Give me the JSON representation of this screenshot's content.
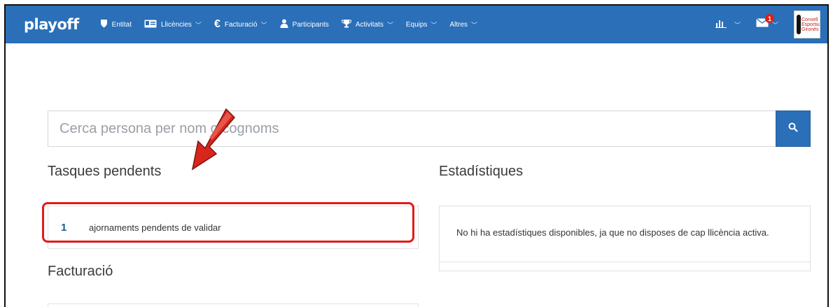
{
  "navbar": {
    "brand": "playoff",
    "items": [
      {
        "label": "Entitat",
        "icon": "shield-icon",
        "dropdown": false
      },
      {
        "label": "Llicències",
        "icon": "id-card-icon",
        "dropdown": true
      },
      {
        "label": "Facturació",
        "icon": "euro-icon",
        "dropdown": true
      },
      {
        "label": "Participants",
        "icon": "user-icon",
        "dropdown": false
      },
      {
        "label": "Activitats",
        "icon": "trophy-icon",
        "dropdown": true
      },
      {
        "label": "Equips",
        "icon": "",
        "dropdown": true
      },
      {
        "label": "Altres",
        "icon": "",
        "dropdown": true
      }
    ],
    "right": {
      "stats_icon": "bar-chart-icon",
      "mail_icon": "mail-icon",
      "mail_badge": "1",
      "avatar_lines": [
        "Consell",
        "Esportiu",
        "Gironès"
      ]
    }
  },
  "search": {
    "placeholder": "Cerca persona per nom o cognoms"
  },
  "tasks": {
    "title": "Tasques pendents",
    "items": [
      {
        "count": "1",
        "label": "ajornaments pendents de validar"
      }
    ]
  },
  "stats": {
    "title": "Estadístiques",
    "message": "No hi ha estadístiques disponibles, ja que no disposes de cap llicència activa."
  },
  "billing": {
    "title": "Facturació"
  },
  "colors": {
    "navbar_bg": "#2a6fb8",
    "highlight": "#e21b1b",
    "badge": "#d9221b",
    "task_count": "#1b5f8c"
  }
}
